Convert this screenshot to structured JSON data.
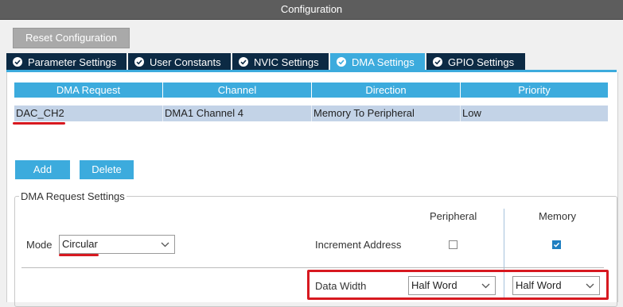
{
  "window": {
    "title": "Configuration"
  },
  "toolbar": {
    "reset_label": "Reset Configuration"
  },
  "tabs": [
    {
      "label": "Parameter Settings",
      "active": false
    },
    {
      "label": "User Constants",
      "active": false
    },
    {
      "label": "NVIC Settings",
      "active": false
    },
    {
      "label": "DMA Settings",
      "active": true
    },
    {
      "label": "GPIO Settings",
      "active": false
    }
  ],
  "dma_table": {
    "columns": [
      "DMA Request",
      "Channel",
      "Direction",
      "Priority"
    ],
    "rows": [
      {
        "request": "DAC_CH2",
        "channel": "DMA1 Channel 4",
        "direction": "Memory To Peripheral",
        "priority": "Low"
      }
    ]
  },
  "actions": {
    "add_label": "Add",
    "delete_label": "Delete"
  },
  "settings": {
    "legend": "DMA Request Settings",
    "peripheral_header": "Peripheral",
    "memory_header": "Memory",
    "mode_label": "Mode",
    "mode_value": "Circular",
    "increment_label": "Increment Address",
    "increment_peripheral": false,
    "increment_memory": true,
    "data_width_label": "Data Width",
    "data_width_peripheral": "Half Word",
    "data_width_memory": "Half Word"
  },
  "colors": {
    "accent": "#3cabdd",
    "tab_dark": "#0c2a44",
    "annotation_red": "#d71920",
    "row_selected": "#c3d3e7"
  }
}
